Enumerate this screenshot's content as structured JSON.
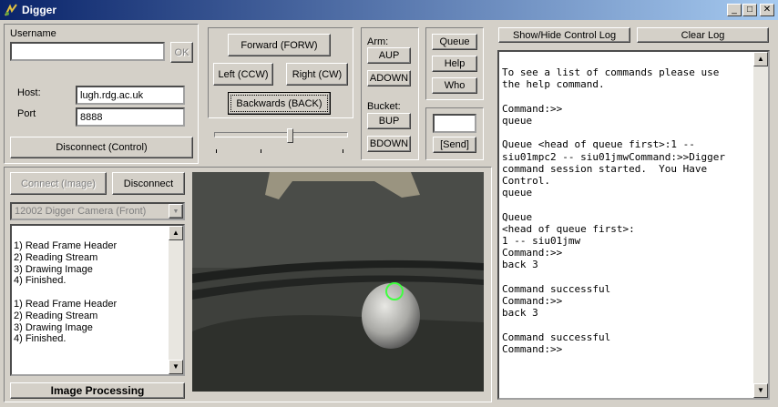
{
  "window": {
    "title": "Digger",
    "min": "_",
    "max": "□",
    "close": "✕"
  },
  "login": {
    "username_label": "Username",
    "username_value": "",
    "ok_label": "OK"
  },
  "host": {
    "host_label": "Host:",
    "host_value": "lugh.rdg.ac.uk",
    "port_label": "Port",
    "port_value": "8888"
  },
  "disconnect_control_label": "Disconnect (Control)",
  "image": {
    "connect_label": "Connect (Image)",
    "disconnect_label": "Disconnect",
    "camera_select": "12002 Digger Camera (Front)",
    "processing_label": "Image Processing"
  },
  "image_log": [
    "1) Read Frame Header",
    "2) Reading Stream",
    "3) Drawing Image",
    "4) Finished.",
    "",
    "1) Read Frame Header",
    "2) Reading Stream",
    "3) Drawing Image",
    "4) Finished."
  ],
  "motion": {
    "forward": "Forward (FORW)",
    "left": "Left (CCW)",
    "right": "Right (CW)",
    "back": "Backwards (BACK)",
    "speed_level": 0.57
  },
  "arm": {
    "label": "Arm:",
    "up": "AUP",
    "down": "ADOWN"
  },
  "bucket": {
    "label": "Bucket:",
    "up": "BUP",
    "down": "BDOWN"
  },
  "queue": {
    "queue": "Queue",
    "help": "Help",
    "who": "Who",
    "send_value": "",
    "send_label": "[Send]"
  },
  "log": {
    "show_hide_label": "Show/Hide Control Log",
    "clear_label": "Clear Log",
    "lines": [
      "",
      "To see a list of commands please use",
      "the help command.",
      "",
      "Command:>>",
      "queue",
      "",
      "Queue <head of queue first>:1 --",
      "siu01mpc2 -- siu01jmwCommand:>>Digger",
      "command session started.  You Have",
      "Control.",
      "queue",
      "",
      "Queue",
      "<head of queue first>:",
      "1 -- siu01jmw",
      "Command:>>",
      "back 3",
      "",
      "Command successful",
      "Command:>>",
      "back 3",
      "",
      "Command successful",
      "Command:>>"
    ]
  }
}
